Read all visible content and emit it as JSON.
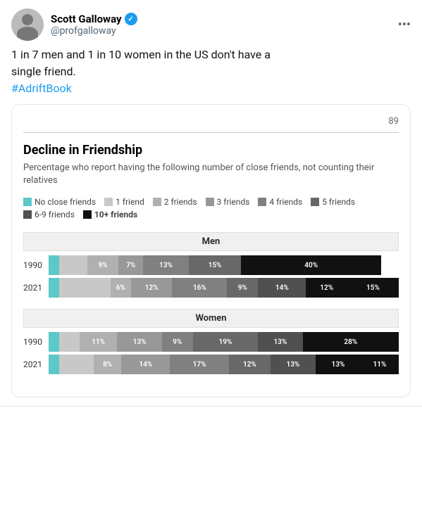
{
  "tweet": {
    "user": {
      "display_name": "Scott Galloway",
      "username": "@profgalloway",
      "verified": true
    },
    "more_icon": "•••",
    "text_line1": "1 in 7 men and 1 in 10 women in the US don't have a",
    "text_line2": "single friend.",
    "hashtag": "#AdriftBook"
  },
  "card": {
    "page_num": "89",
    "divider": true,
    "title": "Decline in Friendship",
    "subtitle": "Percentage who report having the following number of close friends, not counting their relatives",
    "legend": [
      {
        "label": "No close friends",
        "color": "teal"
      },
      {
        "label": "1 friend",
        "color": "gray1"
      },
      {
        "label": "2 friends",
        "color": "gray2"
      },
      {
        "label": "3 friends",
        "color": "gray3"
      },
      {
        "label": "4 friends",
        "color": "gray4"
      },
      {
        "label": "5 friends",
        "color": "gray5"
      },
      {
        "label": "6-9 friends",
        "color": "gray6"
      },
      {
        "label": "10+ friends",
        "color": "black"
      }
    ],
    "sections": [
      {
        "label": "Men",
        "rows": [
          {
            "year": "1990",
            "segments": [
              {
                "pct": 3,
                "label": "",
                "color": "teal"
              },
              {
                "pct": 8,
                "label": "8%",
                "color": "gray1"
              },
              {
                "pct": 9,
                "label": "9%",
                "color": "gray2"
              },
              {
                "pct": 7,
                "label": "7%",
                "color": "gray3"
              },
              {
                "pct": 13,
                "label": "13%",
                "color": "gray4"
              },
              {
                "pct": 15,
                "label": "15%",
                "color": "gray5"
              },
              {
                "pct": 0,
                "label": "",
                "color": "gray6"
              },
              {
                "pct": 40,
                "label": "40%",
                "color": "black"
              }
            ]
          },
          {
            "year": "2021",
            "segments": [
              {
                "pct": 3,
                "label": "",
                "color": "teal"
              },
              {
                "pct": 15,
                "label": "15%",
                "color": "gray1"
              },
              {
                "pct": 6,
                "label": "6%",
                "color": "gray2"
              },
              {
                "pct": 12,
                "label": "12%",
                "color": "gray3"
              },
              {
                "pct": 16,
                "label": "16%",
                "color": "gray4"
              },
              {
                "pct": 9,
                "label": "9%",
                "color": "gray5"
              },
              {
                "pct": 14,
                "label": "14%",
                "color": "gray6"
              },
              {
                "pct": 12,
                "label": "12%",
                "color": "black"
              },
              {
                "pct": 15,
                "label": "15%",
                "color": "black"
              }
            ]
          }
        ]
      },
      {
        "label": "Women",
        "rows": [
          {
            "year": "1990",
            "segments": [
              {
                "pct": 3,
                "label": "",
                "color": "teal"
              },
              {
                "pct": 6,
                "label": "6%",
                "color": "gray1"
              },
              {
                "pct": 11,
                "label": "11%",
                "color": "gray2"
              },
              {
                "pct": 13,
                "label": "13%",
                "color": "gray3"
              },
              {
                "pct": 9,
                "label": "9%",
                "color": "gray4"
              },
              {
                "pct": 19,
                "label": "19%",
                "color": "gray5"
              },
              {
                "pct": 13,
                "label": "13%",
                "color": "gray6"
              },
              {
                "pct": 28,
                "label": "28%",
                "color": "black"
              }
            ]
          },
          {
            "year": "2021",
            "segments": [
              {
                "pct": 3,
                "label": "",
                "color": "teal"
              },
              {
                "pct": 10,
                "label": "10%",
                "color": "gray1"
              },
              {
                "pct": 8,
                "label": "8%",
                "color": "gray2"
              },
              {
                "pct": 14,
                "label": "14%",
                "color": "gray3"
              },
              {
                "pct": 17,
                "label": "17%",
                "color": "gray4"
              },
              {
                "pct": 12,
                "label": "12%",
                "color": "gray5"
              },
              {
                "pct": 13,
                "label": "13%",
                "color": "gray6"
              },
              {
                "pct": 13,
                "label": "13%",
                "color": "black"
              },
              {
                "pct": 11,
                "label": "11%",
                "color": "black"
              }
            ]
          }
        ]
      }
    ]
  }
}
